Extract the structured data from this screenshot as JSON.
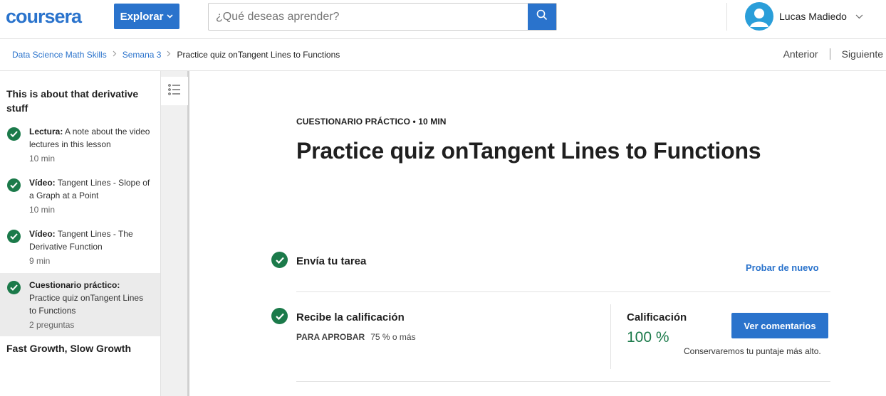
{
  "header": {
    "logo_text": "coursera",
    "explore_label": "Explorar",
    "search_placeholder": "¿Qué deseas aprender?",
    "user_name": "Lucas Madiedo",
    "brand_color": "#2a73cc"
  },
  "breadcrumb": {
    "items": [
      "Data Science Math Skills",
      "Semana 3"
    ],
    "current": "Practice quiz onTangent Lines to Functions"
  },
  "pager": {
    "previous": "Anterior",
    "next": "Siguiente"
  },
  "sidebar": {
    "module_title": "This is about that derivative stuff",
    "items": [
      {
        "type": "Lectura:",
        "name": "A note about the video lectures in this lesson",
        "meta": "10 min"
      },
      {
        "type": "Vídeo:",
        "name": "Tangent Lines - Slope of a Graph at a Point",
        "meta": "10 min"
      },
      {
        "type": "Vídeo:",
        "name": "Tangent Lines - The Derivative Function",
        "meta": "9 min"
      },
      {
        "type": "Cuestionario práctico:",
        "name": "Practice quiz onTangent Lines to Functions",
        "meta": "2 preguntas"
      }
    ],
    "next_module": "Fast Growth, Slow Growth"
  },
  "main": {
    "kicker": "CUESTIONARIO PRÁCTICO • 10 MIN",
    "title": "Practice quiz onTangent Lines to Functions",
    "step1": {
      "label": "Envía tu tarea",
      "action": "Probar de nuevo"
    },
    "step2": {
      "label": "Recibe la calificación",
      "pass_label": "PARA APROBAR",
      "pass_value": "75 % o más",
      "grade_label": "Calificación",
      "grade_value": "100 %",
      "feedback_button": "Ver comentarios",
      "keep_note": "Conservaremos tu puntaje más alto."
    },
    "success_color": "#1b7a4a"
  }
}
